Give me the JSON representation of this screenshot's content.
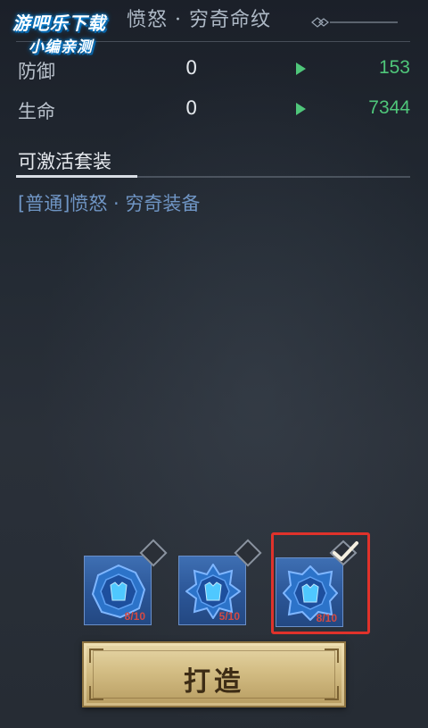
{
  "watermark": {
    "line1": "游吧乐下载",
    "line2": "小编亲测"
  },
  "panel": {
    "title": "愤怒 · 穷奇命纹"
  },
  "stats": [
    {
      "label": "防御",
      "current": "0",
      "next": "153"
    },
    {
      "label": "生命",
      "current": "0",
      "next": "7344"
    }
  ],
  "set_section": {
    "header": "可激活套装",
    "item": "[普通]愤怒 · 穷奇装备"
  },
  "runes": [
    {
      "count": "8/10",
      "state": "unchecked"
    },
    {
      "count": "5/10",
      "state": "unchecked"
    },
    {
      "count": "8/10",
      "state": "checked",
      "selected": true
    }
  ],
  "forge_button": {
    "label": "打造"
  },
  "colors": {
    "accent_green": "#4fc67a",
    "set_item_blue": "#6f95c4",
    "selection_red": "#e0322b",
    "button_gold": "#d3bd84"
  }
}
